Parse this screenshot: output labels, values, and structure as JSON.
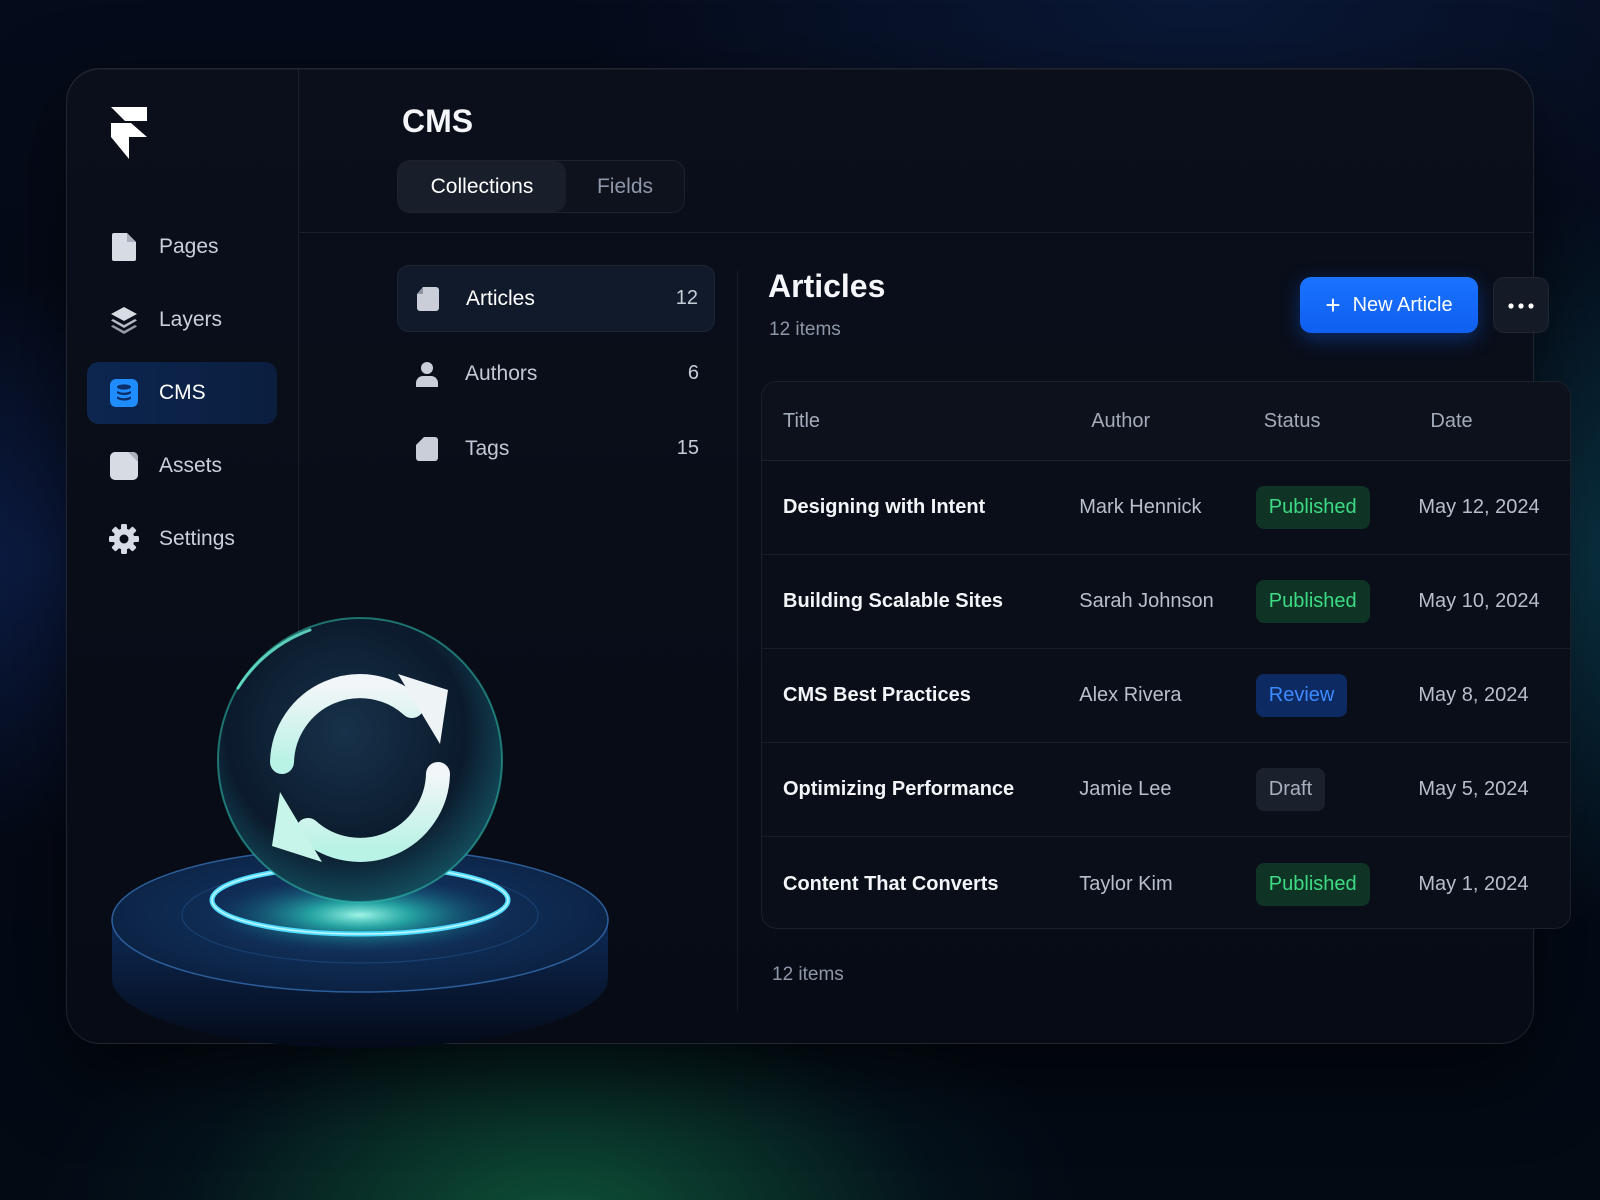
{
  "sidebar": {
    "logo": "framer-logo",
    "items": [
      {
        "label": "Pages",
        "icon": "page-icon"
      },
      {
        "label": "Layers",
        "icon": "layers-icon"
      },
      {
        "label": "CMS",
        "icon": "database-icon",
        "active": true
      },
      {
        "label": "Assets",
        "icon": "image-icon"
      },
      {
        "label": "Settings",
        "icon": "gear-icon"
      }
    ]
  },
  "header": {
    "title": "CMS",
    "tabs": [
      {
        "label": "Collections",
        "active": true
      },
      {
        "label": "Fields",
        "active": false
      }
    ]
  },
  "collections": [
    {
      "label": "Articles",
      "count": "12",
      "icon": "document-icon",
      "active": true
    },
    {
      "label": "Authors",
      "count": "6",
      "icon": "user-icon"
    },
    {
      "label": "Tags",
      "count": "15",
      "icon": "tag-icon"
    }
  ],
  "main": {
    "title": "Articles",
    "subtitle": "12 items",
    "new_button": "New Article",
    "more_button_icon": "ellipsis-icon",
    "table": {
      "headers": {
        "title": "Title",
        "author": "Author",
        "status": "Status",
        "date": "Date"
      },
      "rows": [
        {
          "title": "Designing with Intent",
          "author": "Mark Hennick",
          "status": "Published",
          "date": "May 12, 2024"
        },
        {
          "title": "Building Scalable Sites",
          "author": "Sarah Johnson",
          "status": "Published",
          "date": "May 10, 2024"
        },
        {
          "title": "CMS Best Practices",
          "author": "Alex Rivera",
          "status": "Review",
          "date": "May 8, 2024"
        },
        {
          "title": "Optimizing Performance",
          "author": "Jamie Lee",
          "status": "Draft",
          "date": "May 5, 2024"
        },
        {
          "title": "Content That Converts",
          "author": "Taylor Kim",
          "status": "Published",
          "date": "May 1, 2024"
        }
      ]
    },
    "footer_count": "12 items"
  },
  "colors": {
    "accent": "#1a73ff",
    "published": "#3ddc84",
    "review": "#3d8bff",
    "draft": "#a9b0bd",
    "glow": "#2ee6c8"
  },
  "illustration": {
    "icon": "sync-icon"
  }
}
